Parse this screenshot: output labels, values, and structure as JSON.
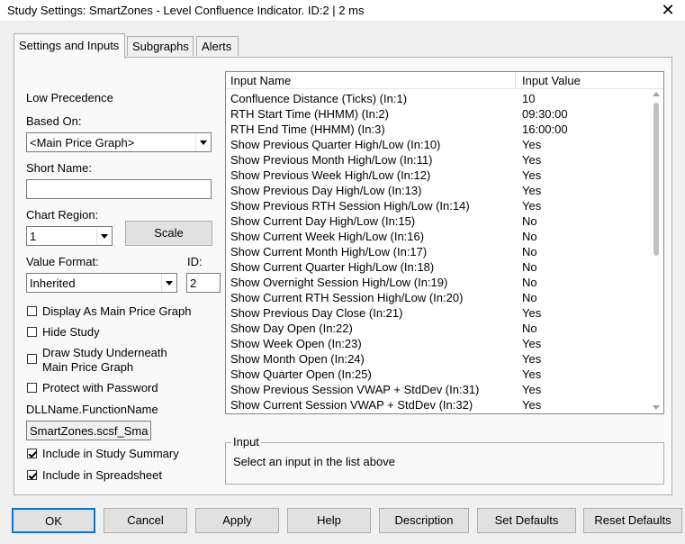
{
  "window": {
    "title": "Study Settings: SmartZones - Level Confluence Indicator. ID:2 | 2 ms",
    "close_glyph": "✕"
  },
  "tabs": [
    {
      "label": "Settings and Inputs",
      "active": true
    },
    {
      "label": "Subgraphs",
      "active": false
    },
    {
      "label": "Alerts",
      "active": false
    }
  ],
  "left": {
    "precedence_text": "Low Precedence",
    "based_on_label": "Based On:",
    "based_on_value": "<Main Price Graph>",
    "short_name_label": "Short Name:",
    "short_name_value": "",
    "chart_region_label": "Chart Region:",
    "chart_region_value": "1",
    "scale_button": "Scale",
    "value_format_label": "Value Format:",
    "value_format_value": "Inherited",
    "id_label": "ID:",
    "id_value": "2",
    "display_as_main_label": "Display As Main Price Graph",
    "display_as_main_checked": false,
    "hide_study_label": "Hide Study",
    "hide_study_checked": false,
    "draw_underneath_label_1": "Draw Study Underneath",
    "draw_underneath_label_2": "Main Price Graph",
    "draw_underneath_checked": false,
    "protect_label": "Protect with Password",
    "protect_checked": false,
    "dll_label": "DLLName.FunctionName",
    "dll_value": "SmartZones.scsf_Sma",
    "include_summary_label": "Include in Study Summary",
    "include_summary_checked": true,
    "include_spreadsheet_label": "Include in Spreadsheet",
    "include_spreadsheet_checked": true
  },
  "inputs_table": {
    "columns": [
      "Input Name",
      "Input Value"
    ],
    "rows": [
      {
        "name": "Confluence Distance (Ticks)   (In:1)",
        "value": "10"
      },
      {
        "name": "RTH Start Time (HHMM)   (In:2)",
        "value": "09:30:00"
      },
      {
        "name": "RTH End Time (HHMM)   (In:3)",
        "value": "16:00:00"
      },
      {
        "name": "Show Previous Quarter High/Low   (In:10)",
        "value": "Yes"
      },
      {
        "name": "Show Previous Month High/Low   (In:11)",
        "value": "Yes"
      },
      {
        "name": "Show Previous Week High/Low   (In:12)",
        "value": "Yes"
      },
      {
        "name": "Show Previous Day High/Low   (In:13)",
        "value": "Yes"
      },
      {
        "name": "Show Previous RTH Session High/Low   (In:14)",
        "value": "Yes"
      },
      {
        "name": "Show Current Day High/Low   (In:15)",
        "value": "No"
      },
      {
        "name": "Show Current Week High/Low   (In:16)",
        "value": "No"
      },
      {
        "name": "Show Current Month High/Low   (In:17)",
        "value": "No"
      },
      {
        "name": "Show Current Quarter High/Low   (In:18)",
        "value": "No"
      },
      {
        "name": "Show Overnight Session High/Low   (In:19)",
        "value": "No"
      },
      {
        "name": "Show Current RTH Session High/Low   (In:20)",
        "value": "No"
      },
      {
        "name": "Show Previous Day Close   (In:21)",
        "value": "Yes"
      },
      {
        "name": "Show Day Open   (In:22)",
        "value": "No"
      },
      {
        "name": "Show Week Open   (In:23)",
        "value": "Yes"
      },
      {
        "name": "Show Month Open   (In:24)",
        "value": "Yes"
      },
      {
        "name": "Show Quarter Open   (In:25)",
        "value": "Yes"
      },
      {
        "name": "Show Previous Session VWAP + StdDev   (In:31)",
        "value": "Yes"
      },
      {
        "name": "Show Current Session VWAP + StdDev   (In:32)",
        "value": "Yes"
      }
    ]
  },
  "input_group": {
    "legend": "Input",
    "text": "Select an input in the list above"
  },
  "buttons": {
    "ok": "OK",
    "cancel": "Cancel",
    "apply": "Apply",
    "help": "Help",
    "description": "Description",
    "set_defaults": "Set Defaults",
    "reset_defaults": "Reset Defaults"
  }
}
